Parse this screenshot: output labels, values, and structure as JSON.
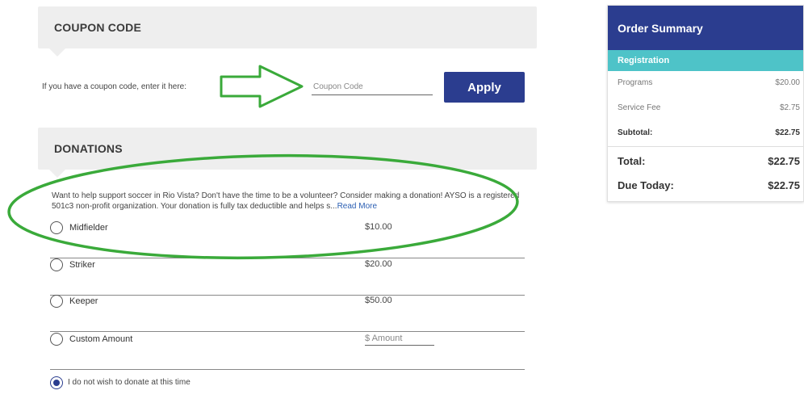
{
  "coupon": {
    "title": "COUPON CODE",
    "prompt": "If you have a coupon code, enter it here:",
    "placeholder": "Coupon Code",
    "apply_label": "Apply"
  },
  "donations": {
    "title": "DONATIONS",
    "description": "Want to help support soccer in Rio Vista? Don't have the time to be a volunteer? Consider making a donation! AYSO is a registered 501c3 non-profit organization. Your donation is fully tax deductible and helps s...",
    "read_more": "Read More",
    "options": [
      {
        "label": "Midfielder",
        "amount": "$10.00"
      },
      {
        "label": "Striker",
        "amount": "$20.00"
      },
      {
        "label": "Keeper",
        "amount": "$50.00"
      }
    ],
    "custom": {
      "label": "Custom Amount",
      "placeholder": "$ Amount"
    },
    "no_donate_label": "I do not wish to donate at this time"
  },
  "summary": {
    "title": "Order Summary",
    "section": "Registration",
    "lines": [
      {
        "label": "Programs",
        "value": "$20.00"
      },
      {
        "label": "Service Fee",
        "value": "$2.75"
      }
    ],
    "subtotal": {
      "label": "Subtotal:",
      "value": "$22.75"
    },
    "total": {
      "label": "Total:",
      "value": "$22.75"
    },
    "due_today": {
      "label": "Due Today:",
      "value": "$22.75"
    }
  },
  "colors": {
    "primary": "#2b3d8f",
    "accent": "#4ec3c8",
    "annotation": "#3aaa3a",
    "link": "#2b5fb3"
  },
  "icons": {
    "annotation_arrow": "right-arrow-annotation-icon",
    "annotation_ellipse": "ellipse-annotation-icon"
  }
}
